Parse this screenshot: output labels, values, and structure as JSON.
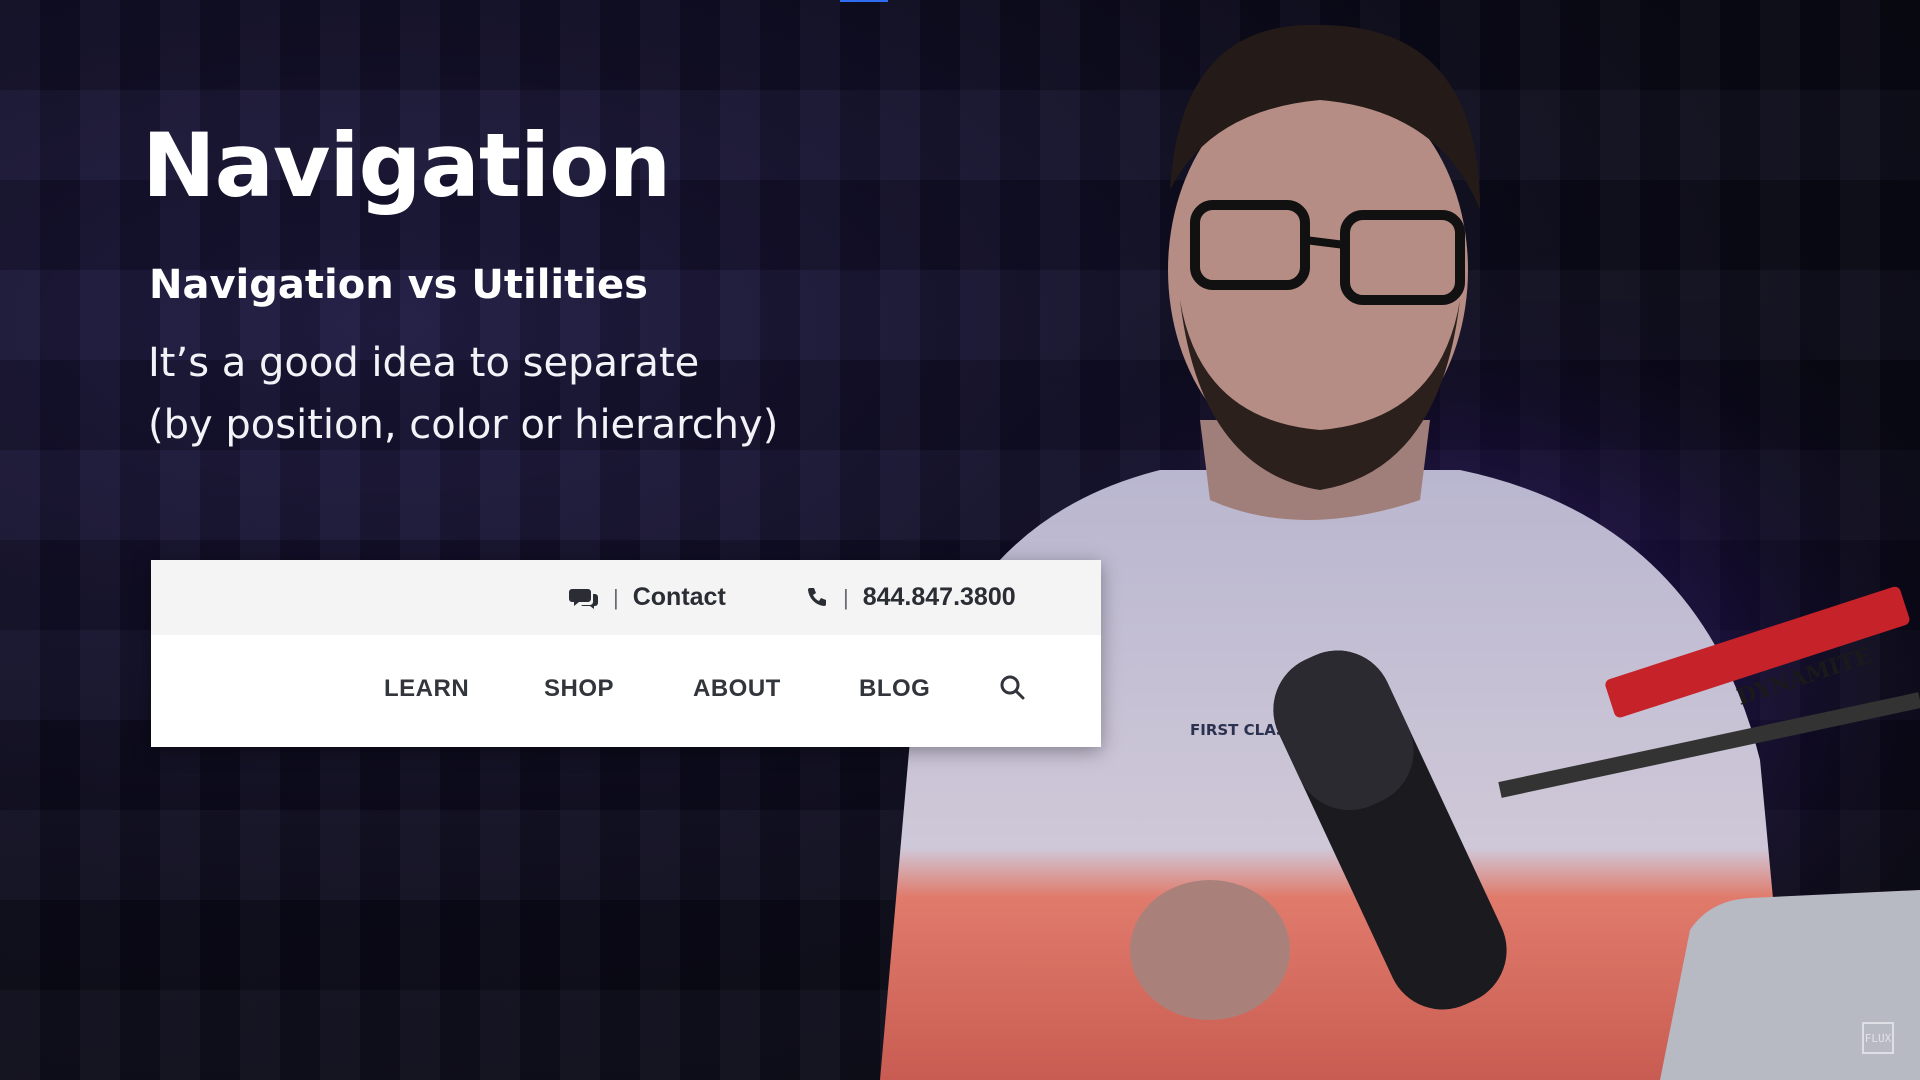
{
  "slide": {
    "title": "Navigation",
    "subtitle": "Navigation vs Utilities",
    "body_line_1": "It’s a good idea to separate",
    "body_line_2": "(by position, color or hierarchy)"
  },
  "utility_bar": {
    "contact_icon": "chat-bubbles-icon",
    "separator": "|",
    "contact_label": "Contact",
    "phone_icon": "phone-icon",
    "phone_number": "844.847.3800"
  },
  "nav": {
    "items": [
      "LEARN",
      "SHOP",
      "ABOUT",
      "BLOG"
    ],
    "search_icon": "search-icon"
  },
  "presenter": {
    "shirt_text": "FIRST CLASS FROM",
    "mic_arm_brand": "DYNAMITE"
  },
  "colors": {
    "accent_blue": "#2e6cf0",
    "header_bg": "#ffffff",
    "utility_bg": "#f4f4f5",
    "nav_text": "#33353c",
    "slide_text": "#ffffff"
  }
}
